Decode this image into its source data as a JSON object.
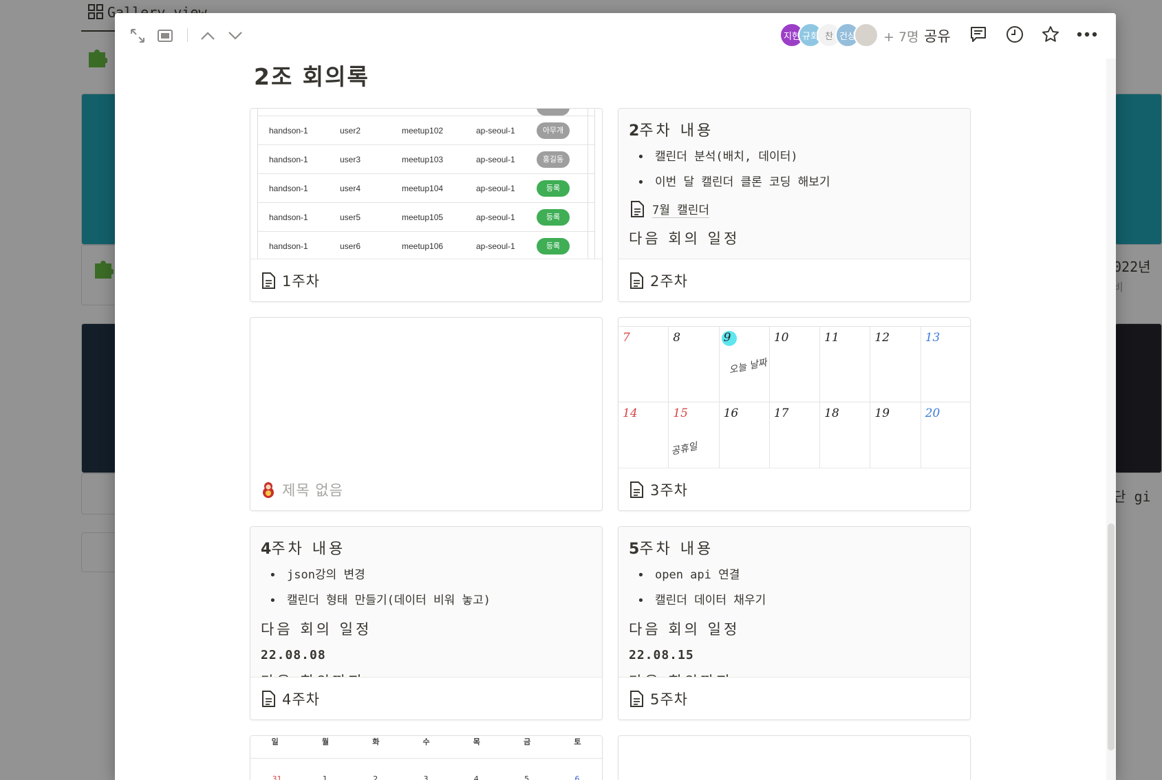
{
  "background": {
    "tab_label": "Gallery view",
    "right_text_1": "022년",
    "right_text_2": "비",
    "right_text_3": "단 gi"
  },
  "modal": {
    "toolbar": {
      "expand_icon": "expand-icon",
      "peek_mode_icon": "peek-mode-icon",
      "prev_icon": "chevron-up-icon",
      "next_icon": "chevron-down-icon"
    },
    "avatars": [
      {
        "label": "지현",
        "color": "#9c3fc7"
      },
      {
        "label": "규회",
        "color": "#8fc7e3"
      },
      {
        "label": "찬",
        "color": "#f2f2f2"
      },
      {
        "label": "건상",
        "color": "#94bedb"
      },
      {
        "label": "",
        "color": "#d8d2cc"
      }
    ],
    "more_members": "+ 7명",
    "share_label": "공유",
    "page_title": "2조  회의록"
  },
  "cards": {
    "week1": {
      "title": "1주차",
      "table_rows": [
        {
          "c1": "handson-1",
          "c2": "user2",
          "c3": "meetup102",
          "c4": "ap-seoul-1",
          "status": "아무개",
          "status_color": "gray"
        },
        {
          "c1": "handson-1",
          "c2": "user3",
          "c3": "meetup103",
          "c4": "ap-seoul-1",
          "status": "홍길동",
          "status_color": "gray"
        },
        {
          "c1": "handson-1",
          "c2": "user4",
          "c3": "meetup104",
          "c4": "ap-seoul-1",
          "status": "등록",
          "status_color": "green"
        },
        {
          "c1": "handson-1",
          "c2": "user5",
          "c3": "meetup105",
          "c4": "ap-seoul-1",
          "status": "등록",
          "status_color": "green"
        },
        {
          "c1": "handson-1",
          "c2": "user6",
          "c3": "meetup106",
          "c4": "ap-seoul-1",
          "status": "등록",
          "status_color": "green"
        }
      ]
    },
    "week2": {
      "title": "2주차",
      "heading_num": "2",
      "heading_rest": "주차 내용",
      "bullets": [
        "캘린더 분석(배치, 데이터)",
        "이번 달 캘린더 클론 코딩 해보기"
      ],
      "link": "7월 캘린더",
      "next_meeting": "다음 회의 일정"
    },
    "untitled": {
      "title": "제목 없음"
    },
    "week3": {
      "title": "3주차",
      "row1": [
        {
          "n": "7",
          "tone": "red"
        },
        {
          "n": "8",
          "tone": ""
        },
        {
          "n": "9",
          "tone": "",
          "highlight": true
        },
        {
          "n": "10",
          "tone": ""
        },
        {
          "n": "11",
          "tone": ""
        },
        {
          "n": "12",
          "tone": ""
        },
        {
          "n": "13",
          "tone": "blue"
        }
      ],
      "row2": [
        {
          "n": "14",
          "tone": "red"
        },
        {
          "n": "15",
          "tone": "red"
        },
        {
          "n": "16",
          "tone": ""
        },
        {
          "n": "17",
          "tone": ""
        },
        {
          "n": "18",
          "tone": ""
        },
        {
          "n": "19",
          "tone": ""
        },
        {
          "n": "20",
          "tone": "blue"
        }
      ],
      "note_9": "오늘 날짜",
      "note_15": "공휴일"
    },
    "week4": {
      "title": "4주차",
      "heading_num": "4",
      "heading_rest": "주차 내용",
      "bullets": [
        "json강의 변경",
        "캘린더 형태 만들기(데이터 비워 놓고)"
      ],
      "next_meeting": "다음 회의 일정",
      "date": "22.08.08",
      "cut": "다음 회의까지"
    },
    "week5": {
      "title": "5주차",
      "heading_num": "5",
      "heading_rest": "주차 내용",
      "bullets": [
        "open api 연결",
        "캘린더 데이터 채우기"
      ],
      "next_meeting": "다음 회의 일정",
      "date": "22.08.15",
      "cut": "다음 회의까지"
    },
    "bottom_cal": {
      "days": [
        "일",
        "월",
        "화",
        "수",
        "목",
        "금",
        "토"
      ],
      "nums": [
        "31",
        "1",
        "2",
        "3",
        "4",
        "5",
        "6"
      ]
    }
  }
}
